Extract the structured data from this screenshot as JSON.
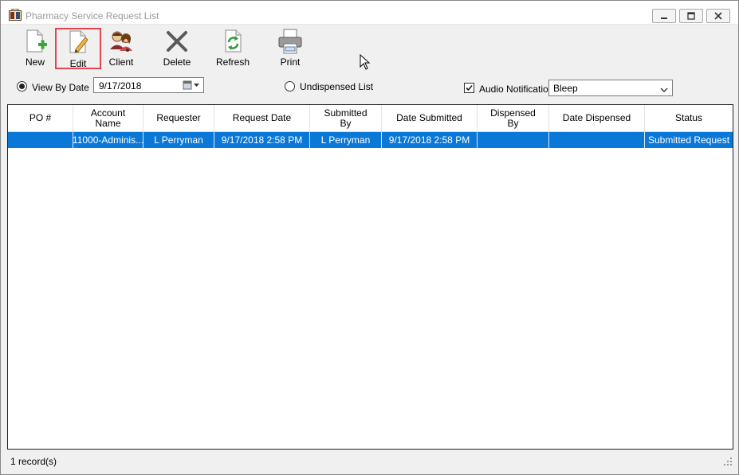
{
  "window": {
    "title": "Pharmacy Service Request List",
    "app_icon": "app-logo-icon",
    "controls": [
      "minimize-icon",
      "maximize-icon",
      "close-icon"
    ]
  },
  "toolbar": {
    "items": [
      {
        "label": "New",
        "icon": "new-document-icon"
      },
      {
        "label": "Edit",
        "icon": "edit-document-icon",
        "highlighted": true
      },
      {
        "label": "Client",
        "icon": "client-people-icon"
      },
      {
        "label": "Delete",
        "icon": "delete-x-icon"
      },
      {
        "label": "Refresh",
        "icon": "refresh-icon"
      },
      {
        "label": "Print",
        "icon": "printer-icon"
      }
    ]
  },
  "filters": {
    "view_by_date_label": "View By Date",
    "view_by_date_selected": true,
    "date_value": "9/17/2018",
    "undispensed_label": "Undispensed List",
    "undispensed_selected": false,
    "audio_label": "Audio Notification",
    "audio_checked": true,
    "audio_sound": "Bleep"
  },
  "grid": {
    "columns": [
      "PO #",
      "Account Name",
      "Requester",
      "Request Date",
      "Submitted By",
      "Date Submitted",
      "Dispensed By",
      "Date Dispensed",
      "Status"
    ],
    "rows": [
      {
        "cells": [
          "",
          "11000-Adminis...",
          "L Perryman",
          "9/17/2018 2:58 PM",
          "L Perryman",
          "9/17/2018 2:58 PM",
          "",
          "",
          "Submitted Request"
        ],
        "selected": true
      }
    ]
  },
  "status": {
    "record_count": "1 record(s)"
  },
  "colors": {
    "selection": "#0a78d7",
    "highlight_border": "#e0464e",
    "window_bg": "#f0f0f0"
  }
}
